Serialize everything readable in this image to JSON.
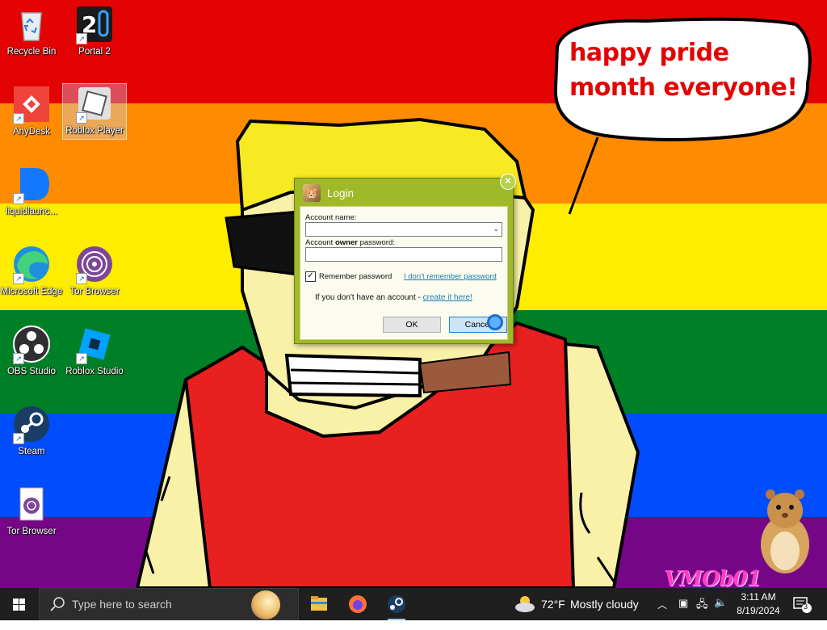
{
  "desktop": {
    "icons": [
      {
        "label": "Recycle Bin"
      },
      {
        "label": "Portal 2"
      },
      {
        "label": "AnyDesk"
      },
      {
        "label": "Roblox Player"
      },
      {
        "label": "liquidlaunc..."
      },
      {
        "label": "Microsoft Edge"
      },
      {
        "label": "Tor Browser"
      },
      {
        "label": "OBS Studio"
      },
      {
        "label": "Roblox Studio"
      },
      {
        "label": "Steam"
      },
      {
        "label": "Tor Browser"
      }
    ],
    "speech_bubble": "happy pride month everyone!",
    "watermark": "VMOb01"
  },
  "login_dialog": {
    "title": "Login",
    "account_name_label": "Account name:",
    "account_name_value": "",
    "password_label_pre": "Account ",
    "password_label_bold": "owner",
    "password_label_post": " password:",
    "password_value": "",
    "remember_label": "Remember password",
    "remember_checked": true,
    "forgot_link": "I don't remember password",
    "no_account_text": "If you don't have an account - ",
    "create_link": "create it here!",
    "ok_button": "OK",
    "cancel_button": "Cancel"
  },
  "taskbar": {
    "search_placeholder": "Type here to search",
    "weather_temp": "72°F",
    "weather_desc": "Mostly cloudy",
    "time": "3:11 AM",
    "date": "8/19/2024",
    "notification_count": "3"
  }
}
